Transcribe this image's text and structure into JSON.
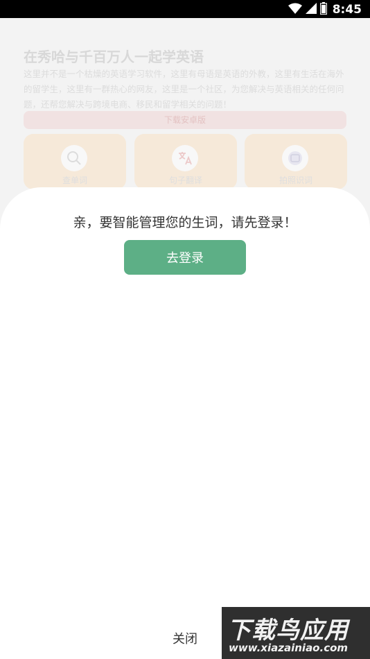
{
  "status_bar": {
    "time": "8:45",
    "icons": [
      "wifi-icon",
      "signal-icon",
      "battery-icon"
    ]
  },
  "background": {
    "title": "在秀哈与千百万人一起学英语",
    "description": "这里并不是一个枯燥的英语学习软件，这里有母语是英语的外教，这里有生活在海外的留学生，这里有一群热心的网友，这里是一个社区，为您解决与英语相关的任何问题，还帮您解决与跨境电商、移民和留学相关的问题！",
    "download_label": "下载安卓版",
    "cards": [
      {
        "label": "查单词",
        "icon": "search-icon"
      },
      {
        "label": "句子翻译",
        "icon": "translate-icon"
      },
      {
        "label": "拍照识词",
        "icon": "camera-icon"
      }
    ]
  },
  "modal": {
    "prompt": "亲，要智能管理您的生词，请先登录！",
    "login_label": "去登录",
    "close_label": "关闭"
  },
  "watermark": {
    "main": "下载鸟应用",
    "url": "www.xiazainiao.com"
  },
  "colors": {
    "primary": "#5daf86",
    "status_bar": "#000000",
    "card_bg": "#f6e9d9"
  }
}
